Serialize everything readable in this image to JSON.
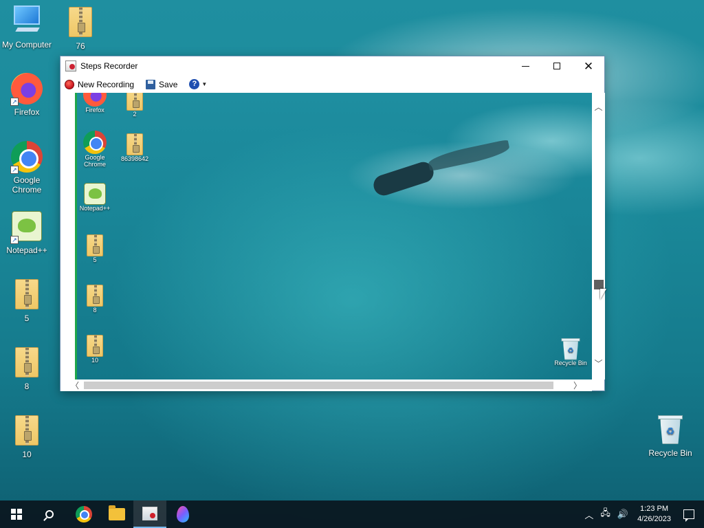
{
  "desktop": {
    "icons": [
      {
        "label": "My Computer",
        "icon": "computer-icon"
      },
      {
        "label": "76",
        "icon": "zip-folder-icon"
      },
      {
        "label": "Firefox",
        "icon": "firefox-icon"
      },
      {
        "label": "Google Chrome",
        "icon": "chrome-icon"
      },
      {
        "label": "Notepad++",
        "icon": "notepad-plus-plus-icon"
      },
      {
        "label": "5",
        "icon": "zip-folder-icon"
      },
      {
        "label": "8",
        "icon": "zip-folder-icon"
      },
      {
        "label": "10",
        "icon": "zip-folder-icon"
      },
      {
        "label": "Recycle Bin",
        "icon": "recycle-bin-icon"
      }
    ]
  },
  "window": {
    "title": "Steps Recorder",
    "toolbar": {
      "new_recording_label": "New Recording",
      "save_label": "Save",
      "help_glyph": "?"
    },
    "screenshot_icons": [
      {
        "label": "Firefox"
      },
      {
        "label": "2"
      },
      {
        "label": "Google Chrome"
      },
      {
        "label": "86398642"
      },
      {
        "label": "Notepad++"
      },
      {
        "label": "5"
      },
      {
        "label": "8"
      },
      {
        "label": "10"
      },
      {
        "label": "Recycle Bin"
      }
    ]
  },
  "taskbar": {
    "time": "1:23 PM",
    "date": "4/26/2023"
  },
  "colors": {
    "recording_border": "#1fa64a",
    "taskbar_bg": "#0a161e"
  }
}
